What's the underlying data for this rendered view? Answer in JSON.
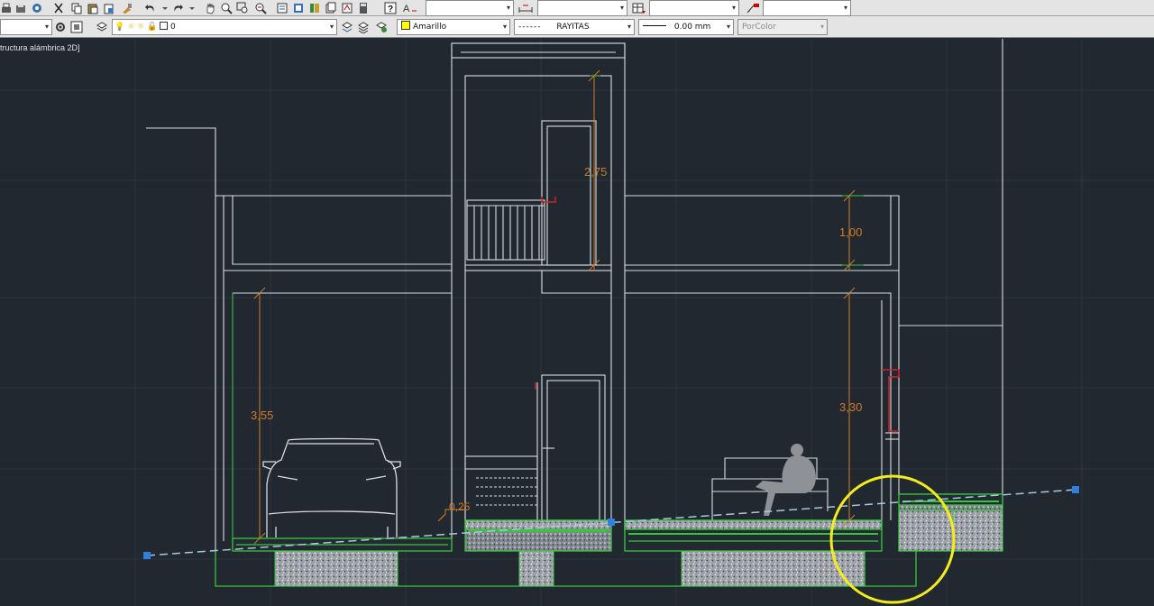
{
  "viewport": {
    "label": "tructura alámbrica 2D]"
  },
  "layer": {
    "name": "0"
  },
  "color_control": {
    "value": "Amarillo",
    "color": "#ffff00"
  },
  "linetype_control": {
    "dash": "------",
    "value": "RAYITAS"
  },
  "lineweight_control": {
    "value": "0.00 mm"
  },
  "plotstyle_control": {
    "value": "PorColor"
  },
  "dimensions": {
    "upper_floor_height": "2,75",
    "parapet_height": "1,00",
    "garage_height": "3,55",
    "ground_floor_height": "3,30",
    "step_height": "0,25"
  },
  "colors": {
    "background": "#212830",
    "wall_lines": "#d8dde2",
    "slab_green": "#39c43f",
    "dimension_orange": "#d07a2a",
    "highlight_circle": "#f5ec1c",
    "grip_blue": "#2f7fe0",
    "accent_red": "#d0202e"
  }
}
